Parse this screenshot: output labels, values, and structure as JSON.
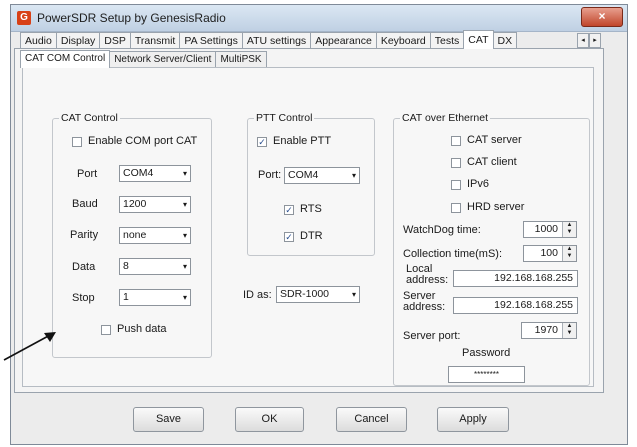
{
  "window": {
    "title": "PowerSDR Setup by GenesisRadio",
    "close_glyph": "×",
    "app_icon_glyph": "G"
  },
  "tabs": [
    "Audio",
    "Display",
    "DSP",
    "Transmit",
    "PA Settings",
    "ATU settings",
    "Appearance",
    "Keyboard",
    "Tests",
    "CAT",
    "DX"
  ],
  "active_tab": "CAT",
  "tab_scroll": {
    "left": "◂",
    "right": "▸"
  },
  "subtabs": [
    "CAT COM Control",
    "Network Server/Client",
    "MultiPSK"
  ],
  "active_subtab": "CAT COM Control",
  "cat_control": {
    "title": "CAT Control",
    "enable_com_label": "Enable COM port CAT",
    "enable_com_checked": false,
    "port_label": "Port",
    "port_value": "COM4",
    "baud_label": "Baud",
    "baud_value": "1200",
    "parity_label": "Parity",
    "parity_value": "none",
    "data_label": "Data",
    "data_value": "8",
    "stop_label": "Stop",
    "stop_value": "1",
    "push_data_label": "Push data",
    "push_data_checked": false
  },
  "ptt_control": {
    "title": "PTT Control",
    "enable_ptt_label": "Enable PTT",
    "enable_ptt_checked": true,
    "port_label": "Port:",
    "port_value": "COM4",
    "rts_label": "RTS",
    "rts_checked": true,
    "dtr_label": "DTR",
    "dtr_checked": true
  },
  "id_as": {
    "label": "ID as:",
    "value": "SDR-1000"
  },
  "cat_over_ethernet": {
    "title": "CAT over Ethernet",
    "cat_server_label": "CAT server",
    "cat_client_label": "CAT client",
    "ipv6_label": "IPv6",
    "hrd_server_label": "HRD server",
    "watchdog_label": "WatchDog time:",
    "watchdog_value": "1000",
    "collection_label": "Collection time(mS):",
    "collection_value": "100",
    "local_label_line1": "Local",
    "local_label_line2": "address:",
    "local_value": "192.168.168.255",
    "server_label_line1": "Server",
    "server_label_line2": "address:",
    "server_value": "192.168.168.255",
    "server_port_label": "Server port:",
    "server_port_value": "1970",
    "password_label": "Password",
    "password_value": "********"
  },
  "checkmark": "✓",
  "dropdown_glyph": "▾",
  "spin_glyph": {
    "up": "▲",
    "down": "▼"
  },
  "buttons": {
    "save": "Save",
    "ok": "OK",
    "cancel": "Cancel",
    "apply": "Apply"
  }
}
